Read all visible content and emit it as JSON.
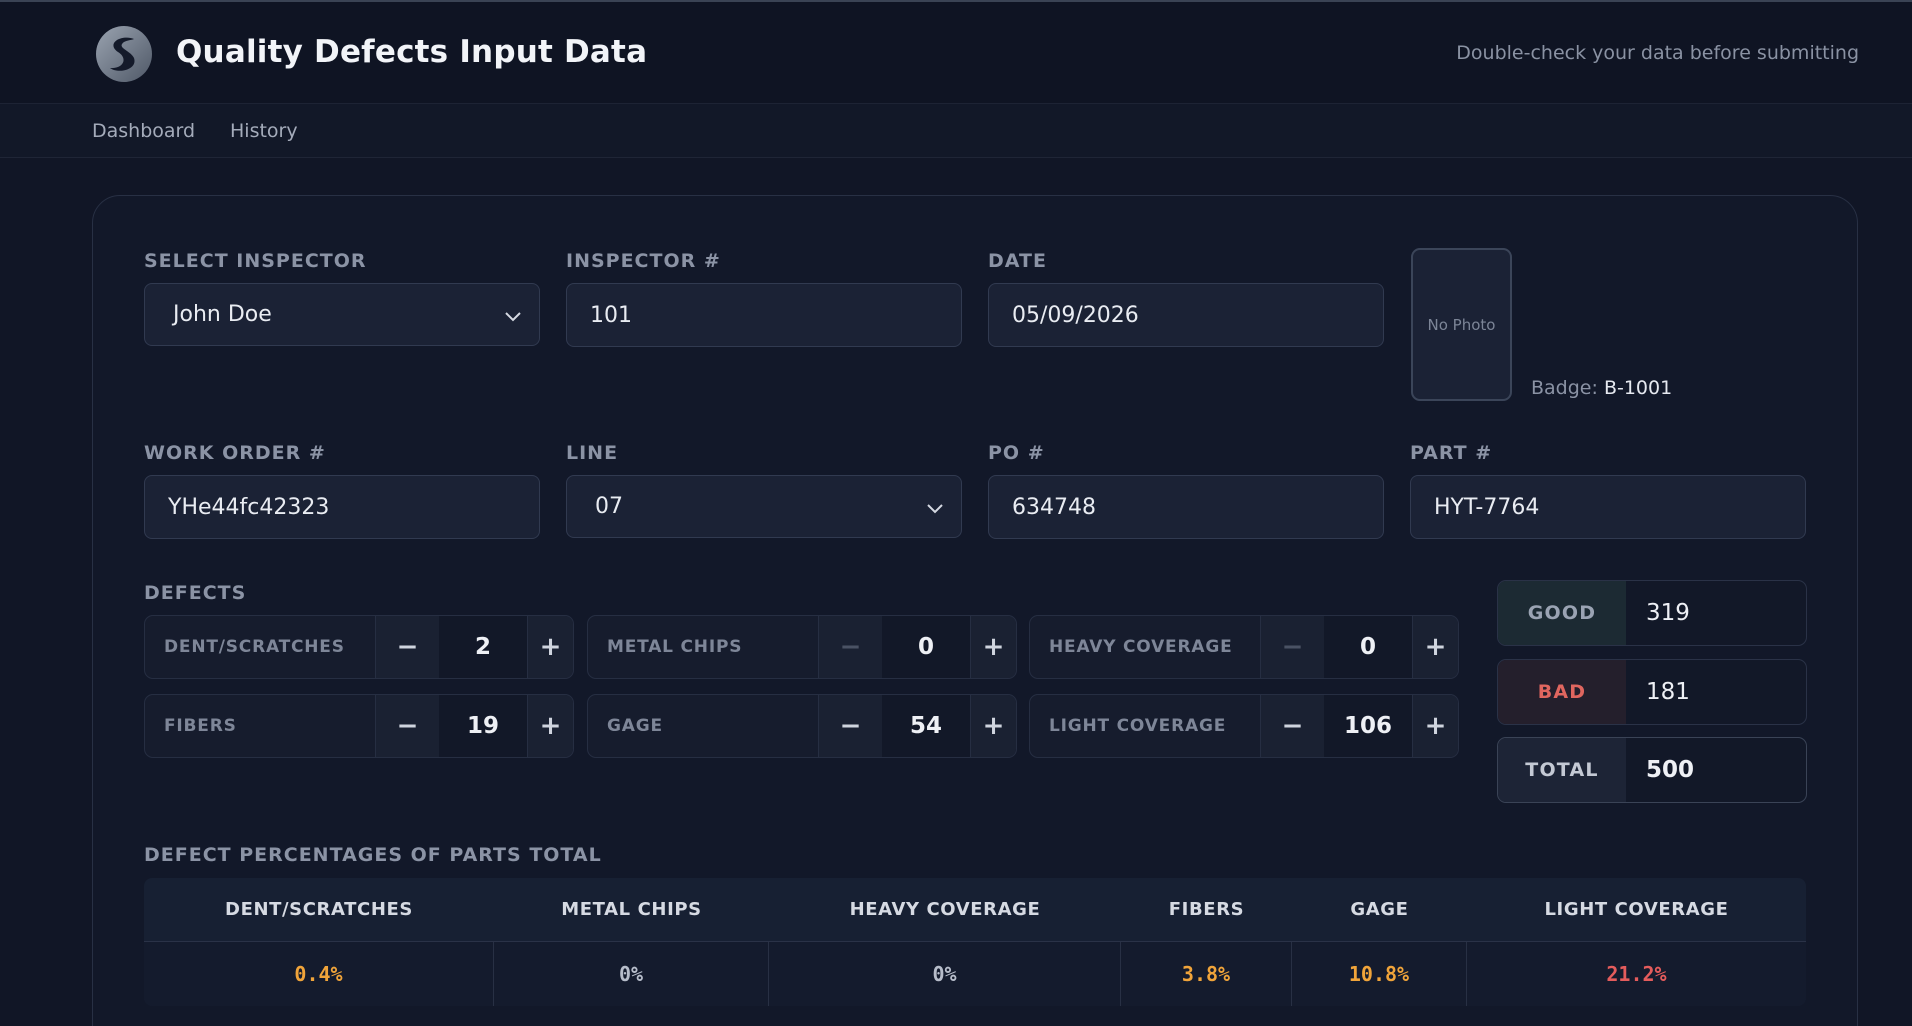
{
  "header": {
    "title": "Quality Defects Input Data",
    "hint": "Double-check your data before submitting"
  },
  "nav": {
    "items": [
      "Dashboard",
      "History"
    ]
  },
  "form": {
    "inspector_label": "SELECT INSPECTOR",
    "inspector_value": "John Doe",
    "inspector_num_label": "INSPECTOR #",
    "inspector_num_value": "101",
    "date_label": "DATE",
    "date_value": "05/09/2026",
    "photo_text": "No Photo",
    "badge_label": "Badge:",
    "badge_value": "B-1001",
    "work_order_label": "WORK ORDER #",
    "work_order_value": "YHe44fc42323",
    "line_label": "LINE",
    "line_value": "07",
    "po_label": "PO #",
    "po_value": "634748",
    "part_label": "PART #",
    "part_value": "HYT-7764"
  },
  "defects": {
    "label": "DEFECTS",
    "items": [
      {
        "name": "DENT/SCRATCHES",
        "value": "2"
      },
      {
        "name": "METAL CHIPS",
        "value": "0"
      },
      {
        "name": "HEAVY COVERAGE",
        "value": "0"
      },
      {
        "name": "FIBERS",
        "value": "19"
      },
      {
        "name": "GAGE",
        "value": "54"
      },
      {
        "name": "LIGHT COVERAGE",
        "value": "106"
      }
    ],
    "minus": "−",
    "plus": "+"
  },
  "summary": {
    "good_label": "GOOD",
    "good_value": "319",
    "bad_label": "BAD",
    "bad_value": "181",
    "total_label": "TOTAL",
    "total_value": "500"
  },
  "percentages": {
    "label": "DEFECT PERCENTAGES OF PARTS TOTAL",
    "headers": [
      "DENT/SCRATCHES",
      "METAL CHIPS",
      "HEAVY COVERAGE",
      "FIBERS",
      "GAGE",
      "LIGHT COVERAGE"
    ],
    "values": [
      "0.4%",
      "0%",
      "0%",
      "3.8%",
      "10.8%",
      "21.2%"
    ]
  },
  "colors": {
    "good": "#9aa3b3",
    "bad": "#e0665f",
    "warn": "#f0a43a",
    "neutral": "#b7bdca",
    "danger": "#e45c5c"
  }
}
